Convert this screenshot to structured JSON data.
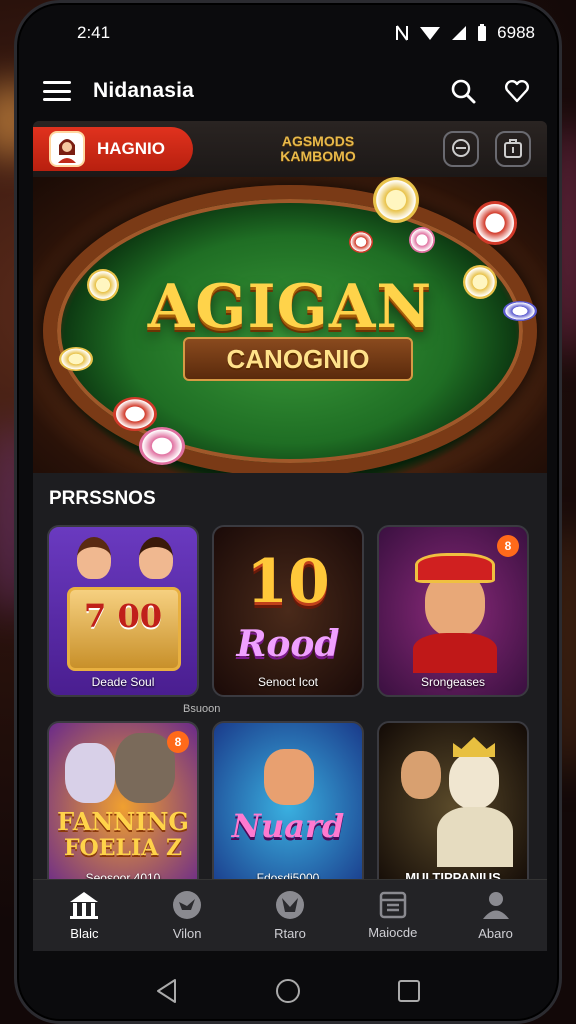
{
  "status_bar": {
    "time": "2:41",
    "right_text": "6988",
    "icons": [
      "nfc-icon",
      "wifi-icon",
      "signal-icon",
      "battery-icon"
    ]
  },
  "app_bar": {
    "title": "Nidanasia",
    "icons": [
      "search-icon",
      "favorite-icon"
    ]
  },
  "top_strip": {
    "brand_label": "HAGNIO",
    "title_line1": "AGSMODS",
    "title_line2": "KAMBOMO",
    "icons": [
      "chat-icon",
      "wallet-icon"
    ]
  },
  "hero": {
    "title": "AGIGAN",
    "subtitle": "CANOGNIO"
  },
  "section": {
    "title": "PRRSSNOS"
  },
  "games": [
    {
      "label": "Deade Soul",
      "art_text": "7 00",
      "badge": ""
    },
    {
      "label": "Senoct Icot",
      "art_text": "10",
      "art_sub": "Rood",
      "badge": ""
    },
    {
      "label": "Srongeases",
      "art_text": "",
      "badge": "8"
    },
    {
      "label": "Seosoor 4010",
      "art_text": "FANNING",
      "art_sub": "FOELIA Z",
      "badge": "8"
    },
    {
      "label": "Fdosdi5000",
      "art_text": "Nuard",
      "badge": ""
    },
    {
      "label": "MULTIPPANIUS",
      "art_text": "",
      "badge": ""
    }
  ],
  "row_caption": "Bsuoon",
  "bottom_nav": [
    {
      "label": "Blaic",
      "icon": "home-icon",
      "active": true
    },
    {
      "label": "Vilon",
      "icon": "bird-icon",
      "active": false
    },
    {
      "label": "Rtaro",
      "icon": "shield-icon",
      "active": false
    },
    {
      "label": "Maiocde",
      "icon": "calendar-icon",
      "active": false
    },
    {
      "label": "Abaro",
      "icon": "person-icon",
      "active": false
    }
  ],
  "colors": {
    "accent": "#e0321e",
    "gold": "#ffd34a",
    "felt": "#2a8a30"
  }
}
